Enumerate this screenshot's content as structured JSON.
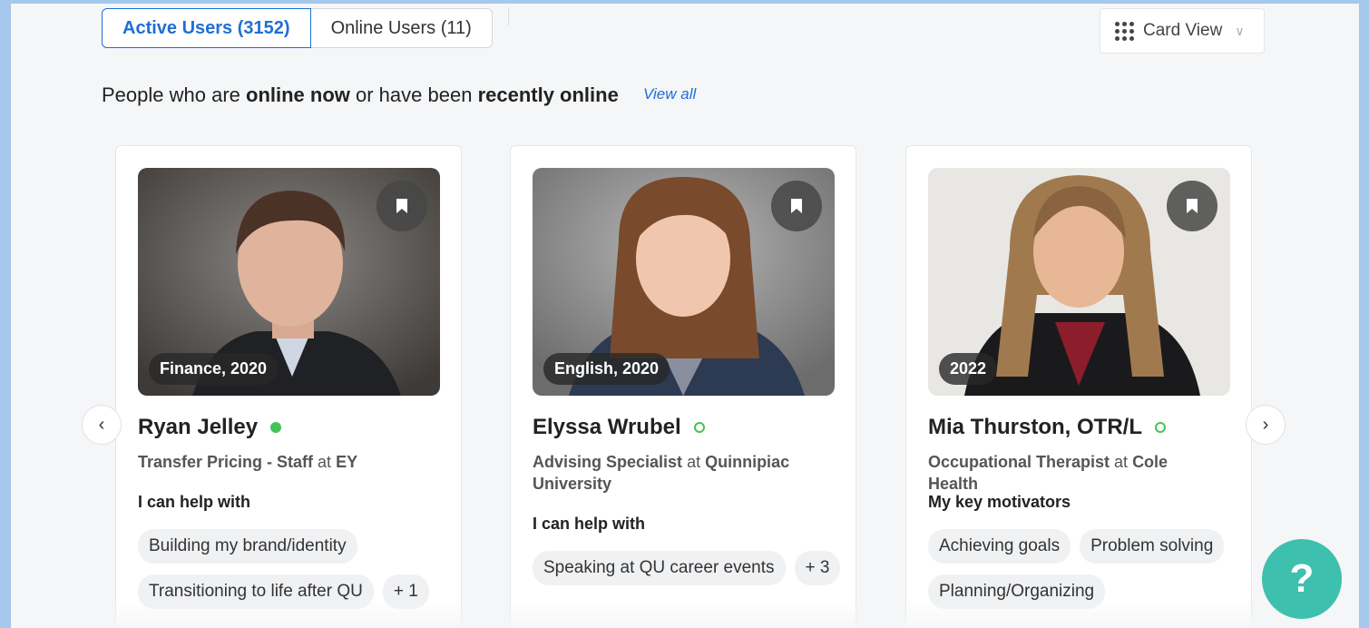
{
  "tabs": [
    {
      "label": "Active Users (3152)",
      "active": true
    },
    {
      "label": "Online Users (11)",
      "active": false
    }
  ],
  "view_select": {
    "label": "Card View",
    "icon": "grid-icon"
  },
  "headline": {
    "part1": "People who are ",
    "bold1": "online now",
    "part2": " or have been ",
    "bold2": "recently online",
    "view_all": "View all"
  },
  "cards": [
    {
      "badge": "Finance, 2020",
      "name": "Ryan Jelley",
      "status": "online",
      "role_title": "Transfer Pricing - Staff",
      "role_at": " at ",
      "org": "EY",
      "section": "I can help with",
      "chips": [
        "Building my brand/identity",
        "Transitioning to life after QU",
        "+ 1"
      ]
    },
    {
      "badge": "English, 2020",
      "name": "Elyssa Wrubel",
      "status": "recent",
      "role_title": "Advising Specialist",
      "role_at": " at ",
      "org": "Quinnipiac University",
      "section": "I can help with",
      "chips": [
        "Speaking at QU career events",
        "+ 3"
      ]
    },
    {
      "badge": "2022",
      "name": "Mia Thurston, OTR/L",
      "status": "recent",
      "role_title": "Occupational Therapist",
      "role_at": " at ",
      "org": "Cole Health",
      "section": "My key motivators",
      "chips": [
        "Achieving goals",
        "Problem solving",
        "Planning/Organizing"
      ]
    }
  ],
  "nav": {
    "prev": "‹",
    "next": "›"
  },
  "help_button": "?",
  "colors": {
    "accent": "#1d6fd6",
    "online": "#45c35a",
    "help": "#3ec0ae"
  }
}
